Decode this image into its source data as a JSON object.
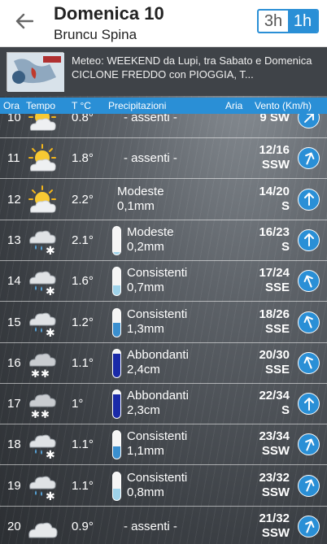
{
  "header": {
    "title": "Domenica 10",
    "subtitle": "Bruncu Spina",
    "toggle": [
      "3h",
      "1h"
    ],
    "active": "1h"
  },
  "news": {
    "text": "Meteo: WEEKEND da Lupi, tra Sabato e Domenica CICLONE FREDDO con PIOGGIA, T..."
  },
  "columns": {
    "ora": "Ora",
    "tempo": "Tempo",
    "temp": "T °C",
    "prec": "Precipitazioni",
    "aria": "Aria",
    "vento": "Vento (Km/h)"
  },
  "rows": [
    {
      "hour": "10",
      "icon": "sun-cloud-icon",
      "temp": "0.8°",
      "prec1": "- assenti -",
      "prec2": "",
      "level": 0,
      "wind1": "9 SW",
      "wind2": "",
      "dir": 225
    },
    {
      "hour": "11",
      "icon": "sun-cloud-icon",
      "temp": "1.8°",
      "prec1": "- assenti -",
      "prec2": "",
      "level": 0,
      "wind1": "12/16",
      "wind2": "SSW",
      "dir": 202
    },
    {
      "hour": "12",
      "icon": "sun-cloud-icon",
      "temp": "2.2°",
      "prec1": "Modeste",
      "prec2": "0,1mm",
      "level": 0,
      "wind1": "14/20",
      "wind2": "S",
      "dir": 180
    },
    {
      "hour": "13",
      "icon": "rain-snow-icon",
      "temp": "2.1°",
      "prec1": "Modeste",
      "prec2": "0,2mm",
      "level": 0.1,
      "wind1": "16/23",
      "wind2": "S",
      "dir": 180
    },
    {
      "hour": "14",
      "icon": "rain-snow-icon",
      "temp": "1.6°",
      "prec1": "Consistenti",
      "prec2": "0,7mm",
      "level": 0.35,
      "wind1": "17/24",
      "wind2": "SSE",
      "dir": 158
    },
    {
      "hour": "15",
      "icon": "rain-snow-icon",
      "temp": "1.2°",
      "prec1": "Consistenti",
      "prec2": "1,3mm",
      "level": 0.5,
      "wind1": "18/26",
      "wind2": "SSE",
      "dir": 158
    },
    {
      "hour": "16",
      "icon": "snow-icon",
      "temp": "1.1°",
      "prec1": "Abbondanti",
      "prec2": "2,4cm",
      "level": 0.85,
      "wind1": "20/30",
      "wind2": "SSE",
      "dir": 158
    },
    {
      "hour": "17",
      "icon": "snow-icon",
      "temp": "1°",
      "prec1": "Abbondanti",
      "prec2": "2,3cm",
      "level": 0.85,
      "wind1": "22/34",
      "wind2": "S",
      "dir": 180
    },
    {
      "hour": "18",
      "icon": "rain-snow-icon",
      "temp": "1.1°",
      "prec1": "Consistenti",
      "prec2": "1,1mm",
      "level": 0.45,
      "wind1": "23/34",
      "wind2": "SSW",
      "dir": 202
    },
    {
      "hour": "19",
      "icon": "rain-snow-icon",
      "temp": "1.1°",
      "prec1": "Consistenti",
      "prec2": "0,8mm",
      "level": 0.4,
      "wind1": "23/32",
      "wind2": "SSW",
      "dir": 202
    },
    {
      "hour": "20",
      "icon": "cloud-icon",
      "temp": "0.9°",
      "prec1": "- assenti -",
      "prec2": "",
      "level": 0,
      "wind1": "21/32",
      "wind2": "SSW",
      "dir": 202
    }
  ],
  "colors": {
    "accent": "#2a8fd6",
    "gauge_light": "#9fd3ea",
    "gauge_mid": "#3a8fcf",
    "gauge_dark": "#1a2aa8"
  }
}
